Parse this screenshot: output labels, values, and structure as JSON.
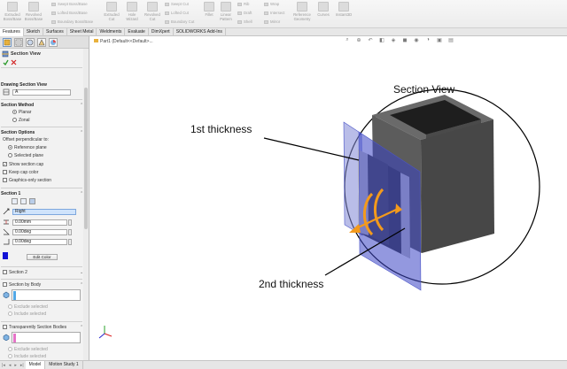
{
  "ribbon": {
    "big_buttons": [
      {
        "label1": "Extruded",
        "label2": "Boss/Base"
      },
      {
        "label1": "Revolved",
        "label2": "Boss/Base"
      },
      {
        "label1": "Extruded",
        "label2": "Cut"
      },
      {
        "label1": "Hole",
        "label2": "Wizard"
      },
      {
        "label1": "Revolved",
        "label2": "Cut"
      },
      {
        "label1": "Fillet",
        "label2": ""
      },
      {
        "label1": "Linear",
        "label2": "Pattern"
      },
      {
        "label1": "Draft",
        "label2": ""
      },
      {
        "label1": "Reference",
        "label2": "Geometry"
      },
      {
        "label1": "Curves",
        "label2": ""
      },
      {
        "label1": "Instant3D",
        "label2": ""
      }
    ],
    "small_buttons": {
      "swept_boss": "Swept Boss/Base",
      "lofted_boss": "Lofted Boss/Base",
      "boundary_boss": "Boundary Boss/Base",
      "swept_cut": "Swept Cut",
      "lofted_cut": "Lofted Cut",
      "boundary_cut": "Boundary Cut",
      "rib": "Rib",
      "shell": "Shell",
      "mirror": "Mirror",
      "wrap": "Wrap",
      "intersect": "Intersect"
    }
  },
  "tabs": [
    "Features",
    "Sketch",
    "Surfaces",
    "Sheet Metal",
    "Weldments",
    "Evaluate",
    "DimXpert",
    "SOLIDWORKS Add-Ins"
  ],
  "panel": {
    "title": "Section View",
    "drawing_section_view": "Drawing Section View",
    "section_name": "A",
    "section_method": {
      "title": "Section Method",
      "planar": "Planar",
      "zonal": "Zonal"
    },
    "section_options": {
      "title": "Section Options",
      "offset_label": "Offset perpendicular to:",
      "reference_plane": "Reference plane",
      "selected_plane": "Selected plane",
      "show_section_cap": "Show section cap",
      "keep_cap_color": "Keep cap color",
      "graphics_only": "Graphics-only section"
    },
    "section1": {
      "title": "Section 1",
      "plane": "Right",
      "offset": "0.00mm",
      "angle1": "0.00deg",
      "angle2": "0.00deg",
      "edit_color": "Edit Color",
      "swatch_color": "#1212d6"
    },
    "section2": {
      "title": "Section 2"
    },
    "section_by_body": {
      "title": "Section by Body",
      "exclude": "Exclude selected",
      "include": "Include selected"
    },
    "transparent_bodies": {
      "title": "Transparently Section Bodies",
      "exclude": "Exclude selected",
      "include": "Include selected"
    }
  },
  "viewport": {
    "breadcrumb": "Part1 (Default<<Default>...",
    "annotations": {
      "section_view": "Section View",
      "first_thickness": "1st thickness",
      "second_thickness": "2nd thickness"
    },
    "colors": {
      "plane": "#4b55c8",
      "body_dark": "#3a3a3a",
      "body_mid": "#575757",
      "body_light": "#bcbcbc",
      "arrow": "#f39a1c"
    }
  },
  "bottom_tabs": [
    "Model",
    "Motion Study 1"
  ]
}
